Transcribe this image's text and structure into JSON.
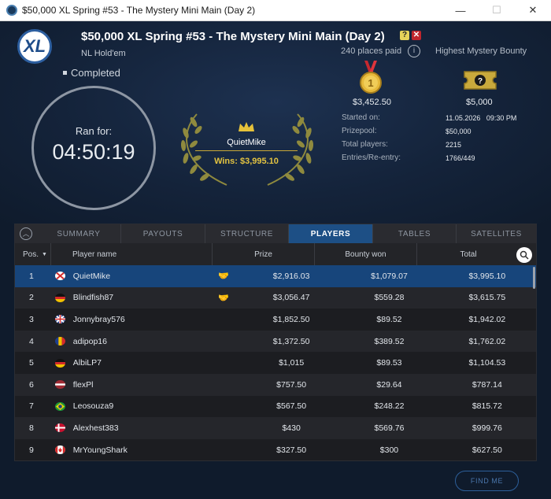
{
  "window": {
    "title": "$50,000 XL Spring #53 - The Mystery Mini Main (Day 2)",
    "minimize": "—",
    "maximize": "☐",
    "close": "✕"
  },
  "header": {
    "logo_text": "XL",
    "title": "$50,000 XL Spring #53 - The Mystery Mini Main (Day 2)",
    "game": "NL Hold'em",
    "places_paid": "240 places paid",
    "info": "i",
    "highest_bounty_label": "Highest Mystery Bounty",
    "status": "Completed",
    "ran_for_label": "Ran for:",
    "ran_for_time": "04:50:19",
    "winner": "QuietMike",
    "winner_wins": "Wins: $3,995.10",
    "first_prize": "$3,452.50",
    "top_bounty": "$5,000",
    "details": [
      {
        "label": "Started on:",
        "value": "11.05.2026   09:30 PM"
      },
      {
        "label": "Prizepool:",
        "value": "$50,000"
      },
      {
        "label": "Total players:",
        "value": "2215"
      },
      {
        "label": "Entries/Re-entry:",
        "value": "1766/449"
      }
    ]
  },
  "tabs": [
    "SUMMARY",
    "PAYOUTS",
    "STRUCTURE",
    "PLAYERS",
    "TABLES",
    "SATELLITES"
  ],
  "active_tab": "PLAYERS",
  "columns": {
    "pos": "Pos.",
    "name": "Player name",
    "prize": "Prize",
    "bounty": "Bounty won",
    "total": "Total"
  },
  "players": [
    {
      "pos": "1",
      "name": "QuietMike",
      "deal": true,
      "prize": "$2,916.03",
      "bounty": "$1,079.07",
      "total": "$3,995.10",
      "country": "jersey"
    },
    {
      "pos": "2",
      "name": "Blindfish87",
      "deal": true,
      "prize": "$3,056.47",
      "bounty": "$559.28",
      "total": "$3,615.75",
      "country": "germany"
    },
    {
      "pos": "3",
      "name": "Jonnybray576",
      "deal": false,
      "prize": "$1,852.50",
      "bounty": "$89.52",
      "total": "$1,942.02",
      "country": "uk"
    },
    {
      "pos": "4",
      "name": "adipop16",
      "deal": false,
      "prize": "$1,372.50",
      "bounty": "$389.52",
      "total": "$1,762.02",
      "country": "romania"
    },
    {
      "pos": "5",
      "name": "AlbiLP7",
      "deal": false,
      "prize": "$1,015",
      "bounty": "$89.53",
      "total": "$1,104.53",
      "country": "germany"
    },
    {
      "pos": "6",
      "name": "flexPl",
      "deal": false,
      "prize": "$757.50",
      "bounty": "$29.64",
      "total": "$787.14",
      "country": "latvia"
    },
    {
      "pos": "7",
      "name": "Leosouza9",
      "deal": false,
      "prize": "$567.50",
      "bounty": "$248.22",
      "total": "$815.72",
      "country": "brazil"
    },
    {
      "pos": "8",
      "name": "Alexhest383",
      "deal": false,
      "prize": "$430",
      "bounty": "$569.76",
      "total": "$999.76",
      "country": "denmark"
    },
    {
      "pos": "9",
      "name": "MrYoungShark",
      "deal": false,
      "prize": "$327.50",
      "bounty": "$300",
      "total": "$627.50",
      "country": "canada"
    }
  ],
  "find_me": "FIND ME",
  "colors": {
    "accent": "#1d4f85",
    "gold": "#e3c341",
    "background": "#0f1b2c"
  }
}
